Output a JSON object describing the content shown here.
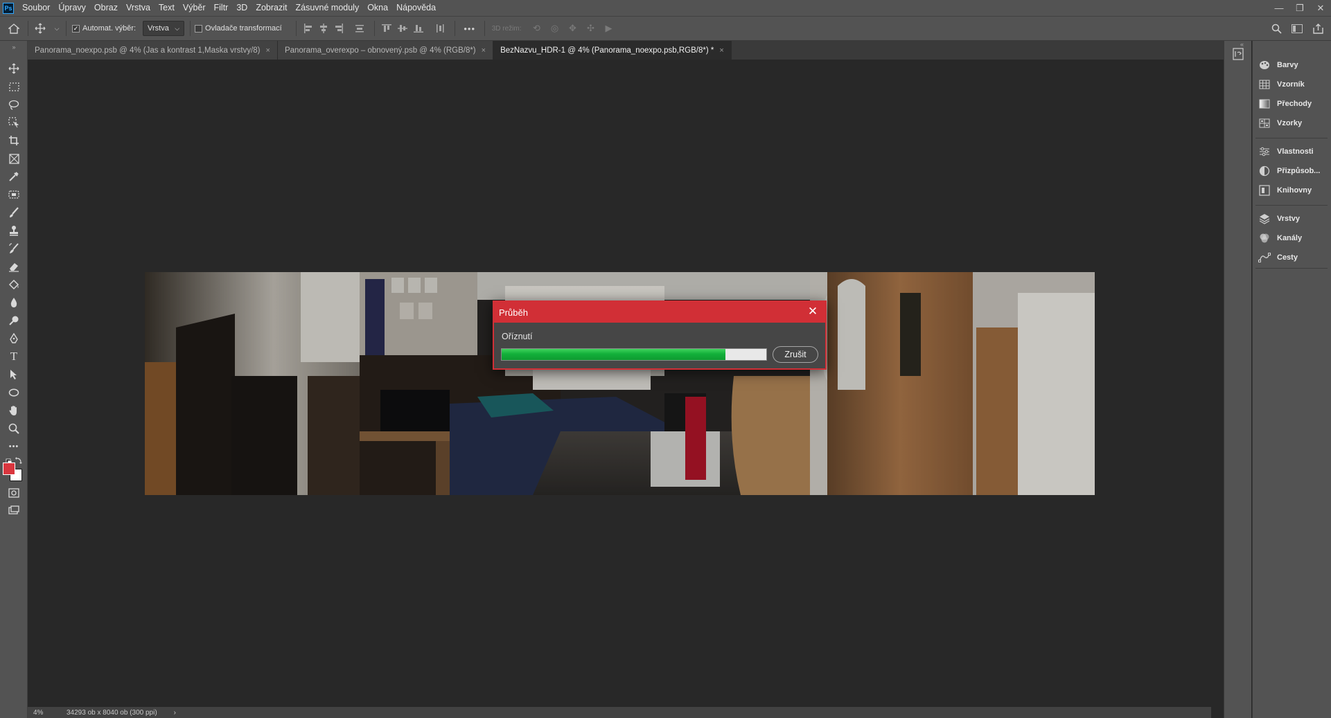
{
  "app": {
    "logo": "Ps"
  },
  "menu": [
    "Soubor",
    "Úpravy",
    "Obraz",
    "Vrstva",
    "Text",
    "Výběr",
    "Filtr",
    "3D",
    "Zobrazit",
    "Zásuvné moduly",
    "Okna",
    "Nápověda"
  ],
  "window_controls": {
    "minimize": "—",
    "restore": "❐",
    "close": "✕"
  },
  "options": {
    "auto_select_label": "Automat. výběr:",
    "auto_select_checked": true,
    "auto_select_value": "Vrstva",
    "transform_controls_label": "Ovladače transformací",
    "transform_controls_checked": false,
    "more_label": "•••",
    "mode_3d_label": "3D režim:"
  },
  "tabs": [
    {
      "label": "Panorama_noexpo.psb @ 4% (Jas a kontrast 1,Maska vrstvy/8)",
      "close": "×",
      "active": false
    },
    {
      "label": "Panorama_overexpo – obnovený.psb @ 4% (RGB/8*)",
      "close": "×",
      "active": false
    },
    {
      "label": "BezNazvu_HDR-1 @ 4% (Panorama_noexpo.psb,RGB/8*) *",
      "close": "×",
      "active": true
    }
  ],
  "tools": [
    "move-tool-icon",
    "rectangular-marquee-icon",
    "lasso-icon",
    "object-selection-icon",
    "crop-icon",
    "frame-icon",
    "eyedropper-icon",
    "spot-healing-icon",
    "brush-icon",
    "clone-stamp-icon",
    "history-brush-icon",
    "eraser-icon",
    "paint-bucket-icon",
    "blur-icon",
    "dodge-icon",
    "pen-icon",
    "type-icon",
    "path-selection-icon",
    "ellipse-icon",
    "hand-icon",
    "zoom-icon",
    "more-tools-icon"
  ],
  "colors": {
    "foreground": "#d9363e",
    "background": "#000000",
    "accent": "#d12f36"
  },
  "panels": [
    {
      "label": "Barvy",
      "icon": "color-palette-icon"
    },
    {
      "label": "Vzorník",
      "icon": "swatches-grid-icon"
    },
    {
      "label": "Přechody",
      "icon": "gradient-icon"
    },
    {
      "label": "Vzorky",
      "icon": "patterns-grid-icon"
    },
    {
      "label": "Vlastnosti",
      "icon": "properties-sliders-icon"
    },
    {
      "label": "Přizpůsob...",
      "icon": "adjustments-icon"
    },
    {
      "label": "Knihovny",
      "icon": "libraries-icon"
    },
    {
      "label": "Vrstvy",
      "icon": "layers-icon"
    },
    {
      "label": "Kanály",
      "icon": "channels-icon"
    },
    {
      "label": "Cesty",
      "icon": "paths-icon"
    }
  ],
  "status": {
    "zoom": "4%",
    "doc_info": "34293 ob x 8040 ob (300 ppi)",
    "arrow": "›"
  },
  "dialog": {
    "title": "Průběh",
    "close": "✕",
    "message": "Oříznutí",
    "progress": 0.845,
    "cancel_label": "Zrušit"
  }
}
